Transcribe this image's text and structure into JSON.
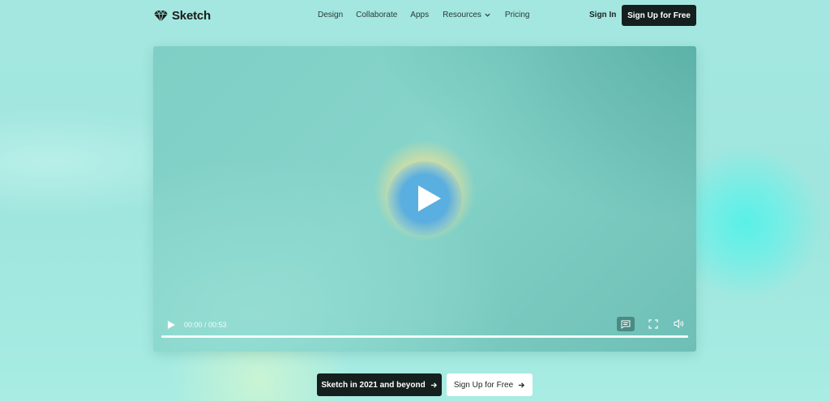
{
  "header": {
    "logo_text": "Sketch",
    "nav": {
      "design": "Design",
      "collaborate": "Collaborate",
      "apps": "Apps",
      "resources": "Resources",
      "pricing": "Pricing"
    },
    "sign_in": "Sign In",
    "sign_up": "Sign Up for Free"
  },
  "video": {
    "time": "00:00 / 00:53",
    "progress_fraction": 1.0
  },
  "cta": {
    "primary": "Sketch in 2021 and beyond",
    "secondary": "Sign Up for Free"
  },
  "colors": {
    "dark": "#15201e",
    "background": "#a6e9e1"
  }
}
